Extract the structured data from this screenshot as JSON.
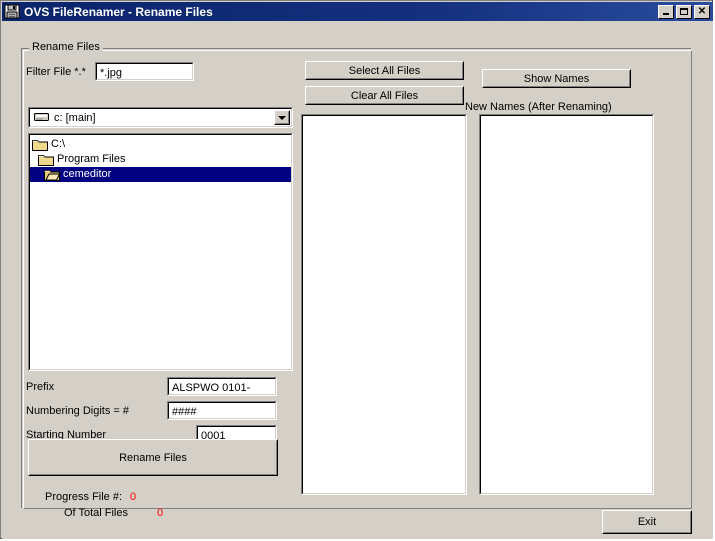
{
  "window": {
    "title": "OVS FileRenamer - Rename Files",
    "icon": "floppy-disk-icon",
    "minimize_label": "",
    "maximize_label": "",
    "close_label": "✕",
    "titlebar_color": "#0a246a",
    "face_color": "#d4d0c8"
  },
  "group": {
    "title": "Rename Files"
  },
  "filter": {
    "label": "Filter File *.*",
    "value": "*.jpg",
    "placeholder": "*.*"
  },
  "drive_combo": {
    "value": "c: [main]",
    "icon": "hard-drive-icon",
    "arrow_icon": "chevron-down-icon"
  },
  "folder_tree": {
    "items": [
      {
        "label": "C:\\",
        "indent": 0,
        "selected": false,
        "icon": "folder-icon"
      },
      {
        "label": "Program Files",
        "indent": 1,
        "selected": false,
        "icon": "folder-icon"
      },
      {
        "label": "cemeditor",
        "indent": 2,
        "selected": true,
        "icon": "folder-open-icon"
      }
    ],
    "selected_color": "#000080"
  },
  "buttons": {
    "select_all_files": "Select All Files",
    "clear_all_files": "Clear All Files",
    "show_names": "Show Names",
    "rename_files": "Rename Files",
    "exit": "Exit"
  },
  "new_names": {
    "label": "New Names (After Renaming)",
    "items": []
  },
  "file_list": {
    "items": []
  },
  "fields": {
    "prefix_label": "Prefix",
    "prefix_value": "ALSPWO 0101-",
    "digits_label": "Numbering Digits = #",
    "digits_value": "####",
    "start_label": "Starting Number",
    "start_value": "0001"
  },
  "progress": {
    "file_label": "Progress File #:",
    "file_value": "0",
    "total_label": "Of Total Files",
    "total_value": "0",
    "value_color": "#ff0000"
  }
}
